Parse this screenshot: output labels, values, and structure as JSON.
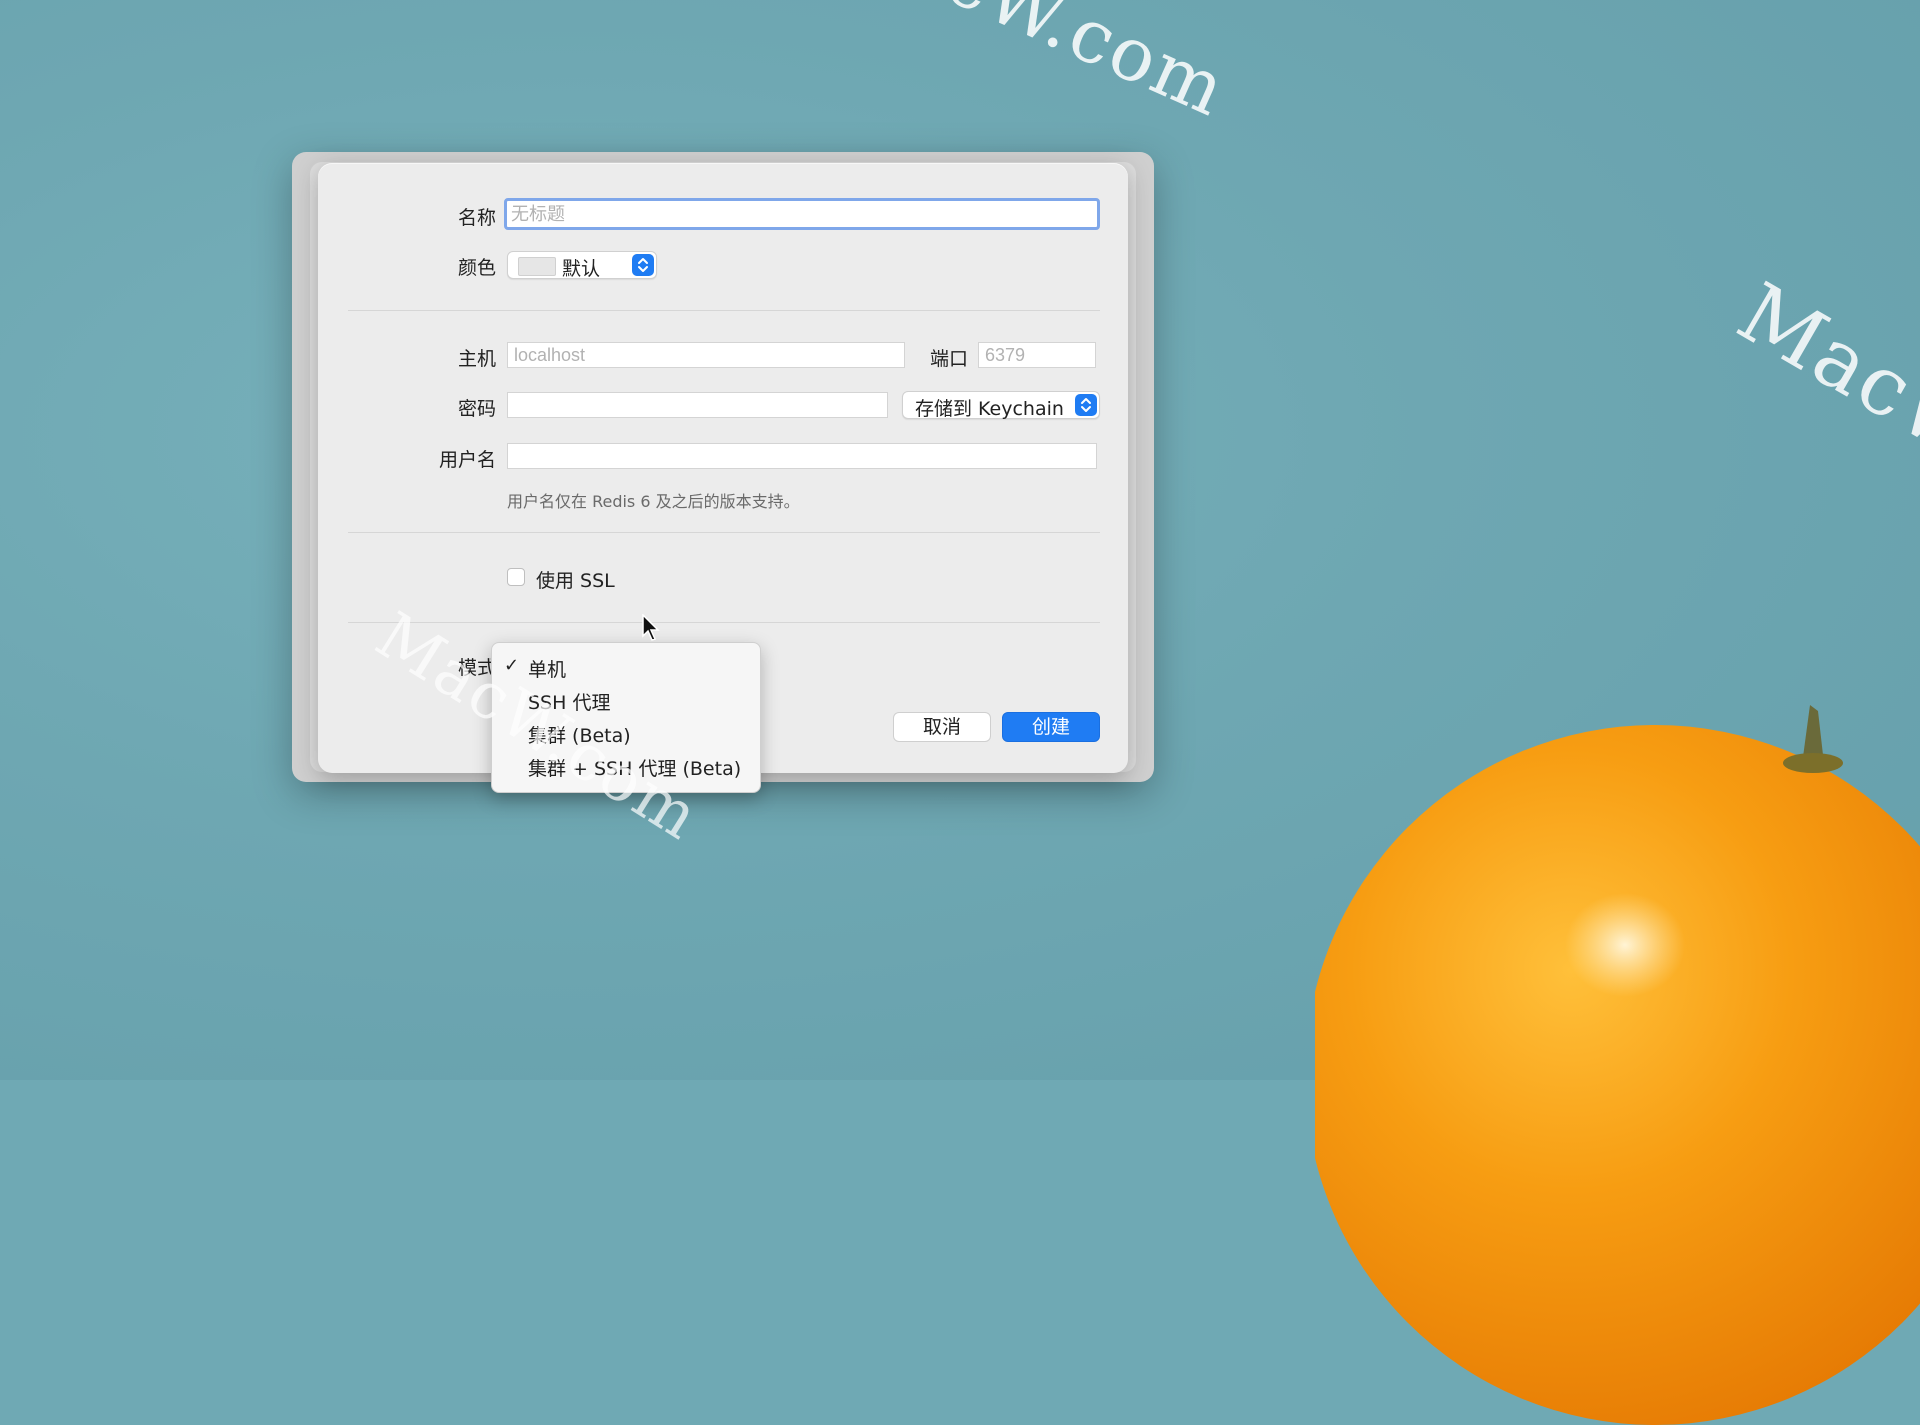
{
  "watermark": {
    "text": "MacW.com"
  },
  "form": {
    "name_label": "名称",
    "name_placeholder": "无标题",
    "color_label": "颜色",
    "color_value": "默认",
    "host_label": "主机",
    "host_placeholder": "localhost",
    "port_label": "端口",
    "port_placeholder": "6379",
    "password_label": "密码",
    "password_store": "存储到 Keychain",
    "username_label": "用户名",
    "username_hint": "用户名仅在 Redis 6 及之后的版本支持。",
    "ssl_label": "使用 SSL",
    "mode_label": "模式"
  },
  "mode_menu": {
    "items": [
      {
        "label": "单机",
        "checked": true
      },
      {
        "label": "SSH 代理",
        "checked": false
      },
      {
        "label": "集群 (Beta)",
        "checked": false
      },
      {
        "label": "集群 + SSH 代理 (Beta)",
        "checked": false
      }
    ],
    "check_glyph": "✓"
  },
  "buttons": {
    "cancel": "取消",
    "create": "创建"
  },
  "colors": {
    "accent": "#1f7cf3",
    "background": "#6fa9b4",
    "orange": "#f59a12"
  }
}
